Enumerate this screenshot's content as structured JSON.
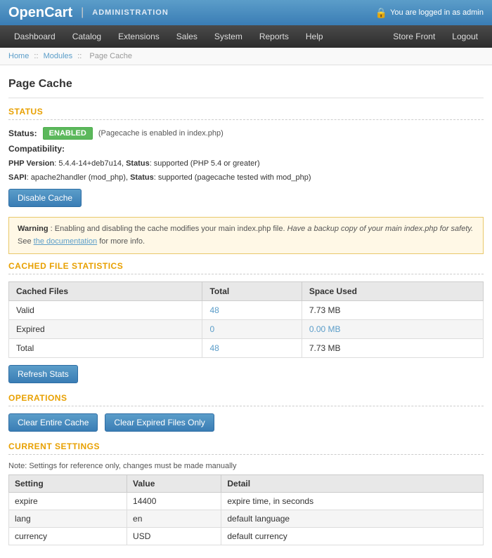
{
  "header": {
    "logo": "OpenCart",
    "separator": "|",
    "admin_label": "ADMINISTRATION",
    "logged_in_text": "You are logged in as admin",
    "lock_icon": "🔒"
  },
  "nav": {
    "left_items": [
      "Dashboard",
      "Catalog",
      "Extensions",
      "Sales",
      "System",
      "Reports",
      "Help"
    ],
    "right_items": [
      "Store Front",
      "Logout"
    ]
  },
  "breadcrumb": {
    "home": "Home",
    "modules": "Modules",
    "current": "Page Cache"
  },
  "page_title": "Page Cache",
  "status_section": {
    "heading": "STATUS",
    "status_label": "Status:",
    "status_value": "ENABLED",
    "status_note": "(Pagecache is enabled in index.php)",
    "compatibility_label": "Compatibility:",
    "php_version_text": "PHP Version: 5.4.4-14+deb7u14, Status: supported (PHP 5.4 or greater)",
    "sapi_text": "SAPI: apache2handler (mod_php), Status: supported (pagecache tested with mod_php)",
    "disable_btn": "Disable Cache",
    "warning_title": "Warning",
    "warning_text": ": Enabling and disabling the cache modifies your main index.php file.",
    "warning_italic": "Have a backup copy of your main index.php for safety.",
    "warning_see": "See",
    "warning_link": "the documentation",
    "warning_end": "for more info."
  },
  "cached_files_section": {
    "heading": "CACHED FILE STATISTICS",
    "columns": [
      "Cached Files",
      "Total",
      "Space Used"
    ],
    "rows": [
      {
        "label": "Valid",
        "total": "48",
        "space": "7.73 MB"
      },
      {
        "label": "Expired",
        "total": "0",
        "space": "0.00 MB"
      },
      {
        "label": "Total",
        "total": "48",
        "space": "7.73 MB"
      }
    ],
    "refresh_btn": "Refresh Stats"
  },
  "operations_section": {
    "heading": "OPERATIONS",
    "clear_entire_btn": "Clear Entire Cache",
    "clear_expired_btn": "Clear Expired Files Only"
  },
  "current_settings_section": {
    "heading": "CURRENT SETTINGS",
    "note": "Note: Settings for reference only, changes must be made manually",
    "columns": [
      "Setting",
      "Value",
      "Detail"
    ],
    "rows": [
      {
        "setting": "expire",
        "value": "14400",
        "detail": "expire time, in seconds"
      },
      {
        "setting": "lang",
        "value": "en",
        "detail": "default language"
      },
      {
        "setting": "currency",
        "value": "USD",
        "detail": "default currency"
      }
    ]
  }
}
